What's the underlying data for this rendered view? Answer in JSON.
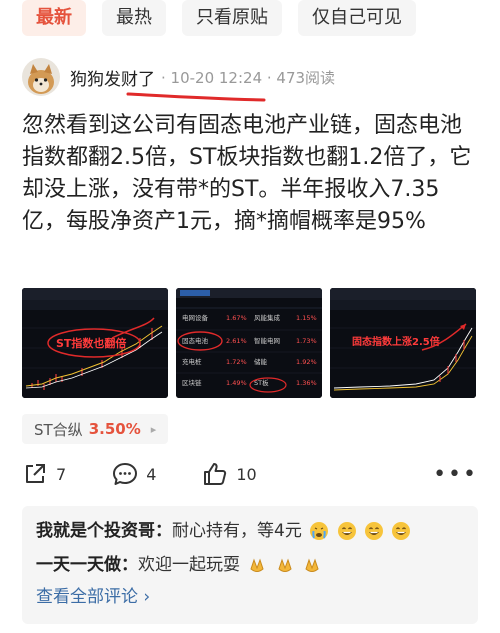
{
  "tabs": [
    {
      "label": "最新",
      "active": true
    },
    {
      "label": "最热",
      "active": false
    },
    {
      "label": "只看原贴",
      "active": false
    },
    {
      "label": "仅自己可见",
      "active": false
    }
  ],
  "post": {
    "author": "狗狗发财了",
    "meta": "· 10-20 12:24 · 473阅读",
    "text": "忽然看到这公司有固态电池产业链，固态电池指数都翻2.5倍，ST板块指数也翻1.2倍了，它却没上涨，没有带*的ST。半年报收入7.35亿，每股净资产1元，摘*摘帽概率是95%"
  },
  "images": {
    "img1_label": "ST指数也翻倍",
    "img2_rows": [
      [
        "电网设备",
        "1.67%",
        "风能集成",
        "1.15%"
      ],
      [
        "固态电池",
        "2.61%",
        "智能电网",
        "1.73%"
      ],
      [
        "充电桩",
        "1.72%",
        "储能",
        "1.92%"
      ],
      [
        "区块链",
        "1.49%",
        "ST板",
        "1.36%"
      ]
    ],
    "img3_label": "固态指数上涨2.5倍"
  },
  "stock": {
    "name": "ST合纵",
    "change": "3.50%"
  },
  "actions": {
    "share_count": "7",
    "comment_count": "4",
    "like_count": "10"
  },
  "comments": [
    {
      "author": "我就是个投资哥：",
      "text": "耐心持有，等4元"
    },
    {
      "author": "一天一天做：",
      "text": "欢迎一起玩耍"
    }
  ],
  "view_all": "查看全部评论",
  "colors": {
    "accent": "#e5533d",
    "link": "#3c6da6"
  }
}
